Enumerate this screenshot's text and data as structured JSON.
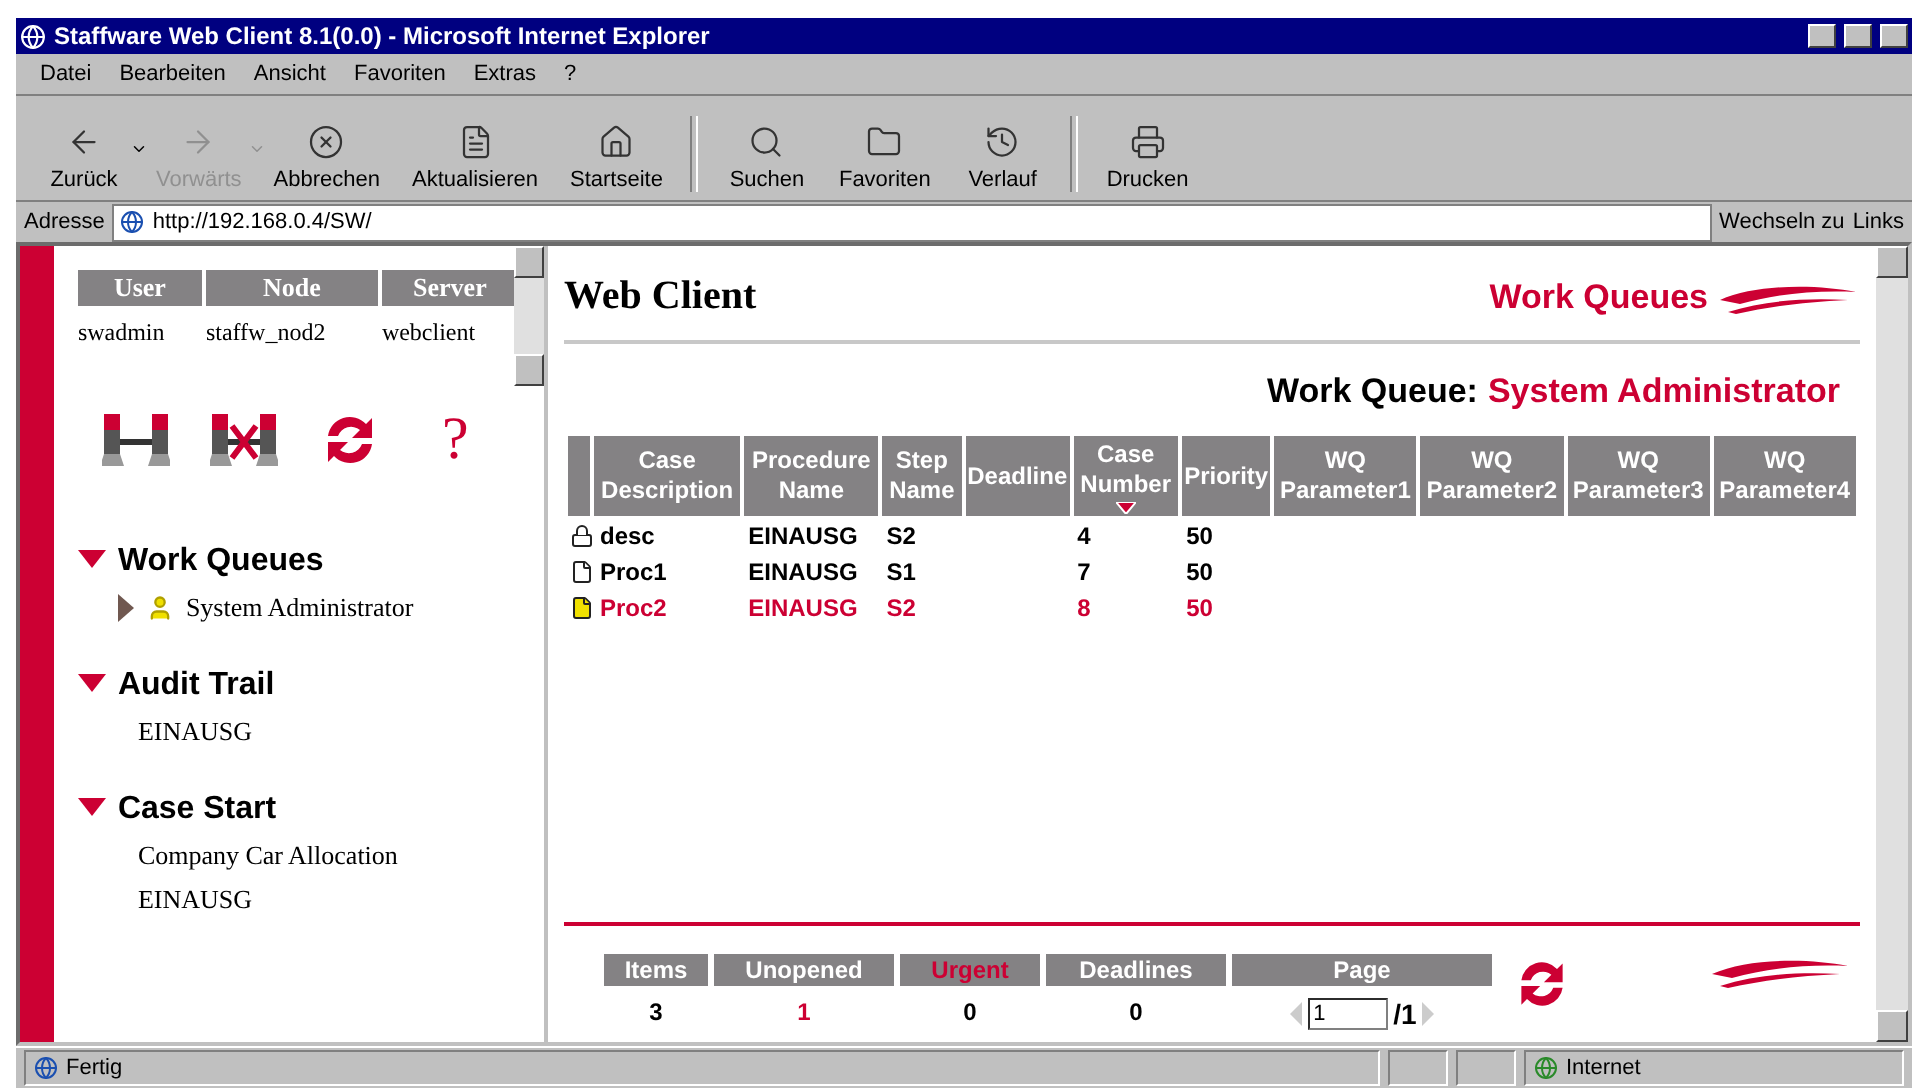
{
  "window": {
    "title": "Staffware Web Client 8.1(0.0) - Microsoft Internet Explorer"
  },
  "menu": [
    "Datei",
    "Bearbeiten",
    "Ansicht",
    "Favoriten",
    "Extras",
    "?"
  ],
  "toolbar": [
    {
      "label": "Zurück",
      "disabled": false,
      "dropdown": true,
      "separator_after": false
    },
    {
      "label": "Vorwärts",
      "disabled": true,
      "dropdown": true,
      "separator_after": false
    },
    {
      "label": "Abbrechen",
      "disabled": false,
      "dropdown": false,
      "separator_after": false
    },
    {
      "label": "Aktualisieren",
      "disabled": false,
      "dropdown": false,
      "separator_after": false
    },
    {
      "label": "Startseite",
      "disabled": false,
      "dropdown": false,
      "separator_after": true
    },
    {
      "label": "Suchen",
      "disabled": false,
      "dropdown": false,
      "separator_after": false
    },
    {
      "label": "Favoriten",
      "disabled": false,
      "dropdown": false,
      "separator_after": false
    },
    {
      "label": "Verlauf",
      "disabled": false,
      "dropdown": false,
      "separator_after": true
    },
    {
      "label": "Drucken",
      "disabled": false,
      "dropdown": false,
      "separator_after": false
    }
  ],
  "address": {
    "label": "Adresse",
    "value": "http://192.168.0.4/SW/",
    "go": "Wechseln zu",
    "links": "Links"
  },
  "sidebar": {
    "user_table": {
      "columns": [
        "User",
        "Node",
        "Server"
      ],
      "values": [
        "swadmin",
        "staffw_nod2",
        "webclient"
      ]
    },
    "help": "?",
    "sections": [
      {
        "title": "Work Queues",
        "expanded": true,
        "children": [
          {
            "label": "System Administrator",
            "kind": "queue"
          }
        ]
      },
      {
        "title": "Audit Trail",
        "expanded": true,
        "children": [
          {
            "label": "EINAUSG",
            "kind": "text"
          }
        ]
      },
      {
        "title": "Case Start",
        "expanded": true,
        "children": [
          {
            "label": "Company Car Allocation",
            "kind": "text"
          },
          {
            "label": "EINAUSG",
            "kind": "text"
          }
        ]
      }
    ]
  },
  "main": {
    "title": "Web Client",
    "brand": "Work Queues",
    "queue_label": "Work Queue:",
    "queue_name": "System Administrator",
    "table": {
      "columns": [
        {
          "label": "Case Description",
          "sorted": false
        },
        {
          "label": "Procedure Name",
          "sorted": false
        },
        {
          "label": "Step Name",
          "sorted": false
        },
        {
          "label": "Deadline",
          "sorted": false
        },
        {
          "label": "Case Number",
          "sorted": true
        },
        {
          "label": "Priority",
          "sorted": false
        },
        {
          "label": "WQ Parameter1",
          "sorted": false
        },
        {
          "label": "WQ Parameter2",
          "sorted": false
        },
        {
          "label": "WQ Parameter3",
          "sorted": false
        },
        {
          "label": "WQ Parameter4",
          "sorted": false
        }
      ],
      "rows": [
        {
          "kind": "locked",
          "urgent": false,
          "cells": [
            "desc",
            "EINAUSG",
            "S2",
            "",
            "4",
            "50",
            "",
            "",
            "",
            ""
          ]
        },
        {
          "kind": "opened",
          "urgent": false,
          "cells": [
            "Proc1",
            "EINAUSG",
            "S1",
            "",
            "7",
            "50",
            "",
            "",
            "",
            ""
          ]
        },
        {
          "kind": "unopened",
          "urgent": true,
          "cells": [
            "Proc2",
            "EINAUSG",
            "S2",
            "",
            "8",
            "50",
            "",
            "",
            "",
            ""
          ]
        }
      ]
    },
    "summary": [
      {
        "label": "Items",
        "value": "3",
        "label_highlighted": false,
        "value_highlighted": false
      },
      {
        "label": "Unopened",
        "value": "1",
        "label_highlighted": false,
        "value_highlighted": true
      },
      {
        "label": "Urgent",
        "value": "0",
        "label_highlighted": true,
        "value_highlighted": false
      },
      {
        "label": "Deadlines",
        "value": "0",
        "label_highlighted": false,
        "value_highlighted": false
      }
    ],
    "page": {
      "label": "Page",
      "value": "1",
      "total": "/1"
    }
  },
  "status_bar": {
    "text": "Fertig",
    "zone": "Internet"
  }
}
